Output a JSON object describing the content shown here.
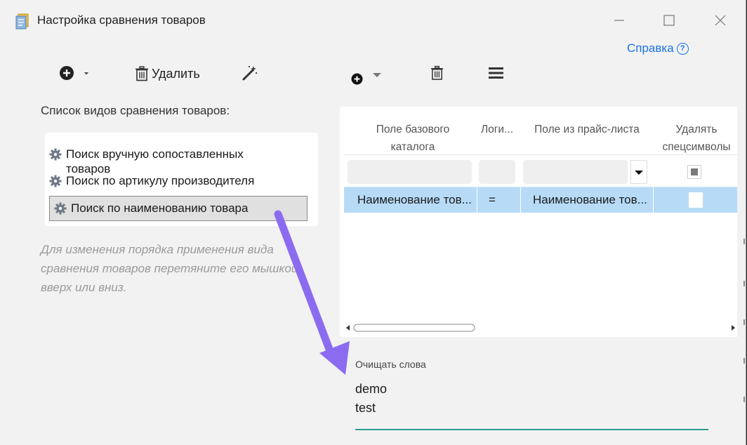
{
  "window": {
    "title": "Настройка сравнения товаров"
  },
  "help": {
    "label": "Справка",
    "icon": "help-circle-icon"
  },
  "left_toolbar": {
    "delete_label": "Удалить"
  },
  "list": {
    "caption": "Список видов сравнения товаров:",
    "items": [
      {
        "label_line1": "Поиск вручную сопоставленных",
        "label_line2": "товаров",
        "selected": false
      },
      {
        "label_line1": "Поиск по артикулу производителя",
        "selected": false
      },
      {
        "label_line1": "Поиск по наименованию товара",
        "selected": true
      }
    ],
    "hint_lines": [
      "Для изменения порядка применения вида",
      "сравнения товаров перетяните его мышкой",
      "вверх или вниз."
    ]
  },
  "grid": {
    "columns": [
      {
        "line1": "Поле базового",
        "line2": "каталога"
      },
      {
        "line1": "Логи..."
      },
      {
        "line1": "Поле из прайс-листа"
      },
      {
        "line1": "Удалять",
        "line2": "спецсимволы"
      }
    ],
    "rows": [
      {
        "base_field": "Наименование тов...",
        "logic": "=",
        "price_field": "Наименование тов...",
        "remove_special": false
      }
    ]
  },
  "clear_words": {
    "label": "Очищать слова",
    "lines": [
      "demo",
      "test"
    ]
  },
  "colors": {
    "accent_link": "#1a73e8",
    "selection": "#b7dbf6",
    "underline": "#2a9d8f",
    "annotation_arrow": "#8b6cf0"
  }
}
